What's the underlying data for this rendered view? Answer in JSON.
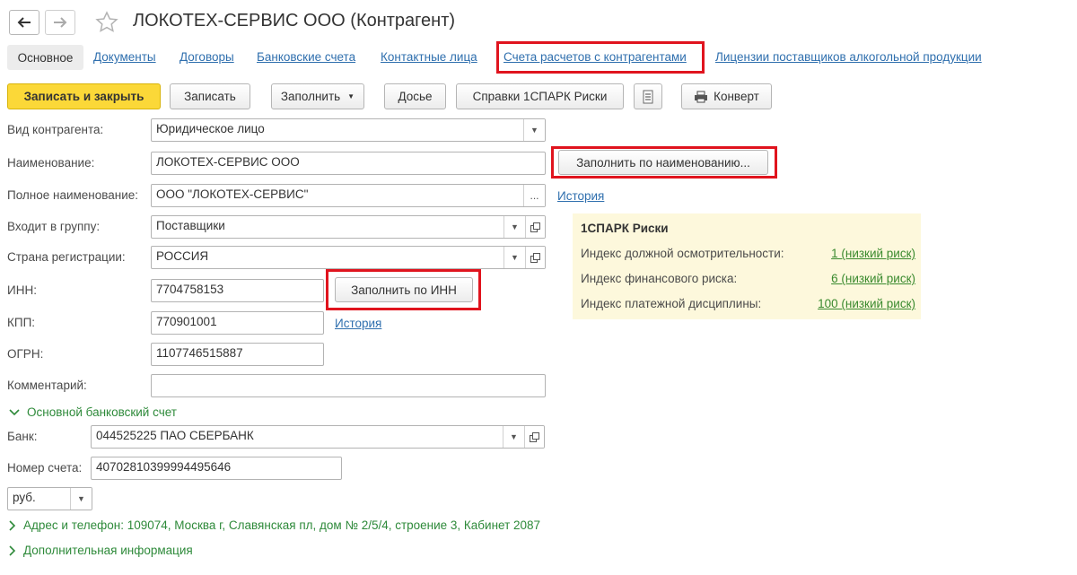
{
  "header": {
    "title": "ЛОКОТЕХ-СЕРВИС ООО (Контрагент)",
    "back_icon": "arrow-left-icon",
    "forward_icon": "arrow-right-icon",
    "favorite_icon": "star-icon"
  },
  "tabs": [
    {
      "label": "Основное",
      "active": true
    },
    {
      "label": "Документы"
    },
    {
      "label": "Договоры"
    },
    {
      "label": "Банковские счета"
    },
    {
      "label": "Контактные лица"
    },
    {
      "label": "Счета расчетов с контрагентами",
      "highlighted": true
    },
    {
      "label": "Лицензии поставщиков алкогольной продукции"
    }
  ],
  "toolbar": {
    "save_close": "Записать и закрыть",
    "save": "Записать",
    "fill": "Заполнить",
    "dossier": "Досье",
    "spark": "Справки 1СПАРК Риски",
    "convert": "Конверт"
  },
  "form": {
    "kind_label": "Вид контрагента:",
    "kind_value": "Юридическое лицо",
    "name_label": "Наименование:",
    "name_value": "ЛОКОТЕХ-СЕРВИС ООО",
    "fill_by_name": "Заполнить по наименованию...",
    "fullname_label": "Полное наименование:",
    "fullname_value": "ООО \"ЛОКОТЕХ-СЕРВИС\"",
    "fullname_more": "...",
    "history_link": "История",
    "group_label": "Входит в группу:",
    "group_value": "Поставщики",
    "country_label": "Страна регистрации:",
    "country_value": "РОССИЯ",
    "inn_label": "ИНН:",
    "inn_value": "7704758153",
    "fill_by_inn": "Заполнить по ИНН",
    "kpp_label": "КПП:",
    "kpp_value": "770901001",
    "kpp_history": "История",
    "ogrn_label": "ОГРН:",
    "ogrn_value": "1107746515887",
    "comment_label": "Комментарий:",
    "comment_value": ""
  },
  "spark": {
    "title": "1СПАРК Риски",
    "rows": [
      {
        "label": "Индекс должной осмотрительности:",
        "value": "1 (низкий риск)"
      },
      {
        "label": "Индекс финансового риска:",
        "value": "6 (низкий риск)"
      },
      {
        "label": "Индекс платежной дисциплины:",
        "value": "100 (низкий риск)"
      }
    ]
  },
  "bank": {
    "section_title": "Основной банковский счет",
    "bank_label": "Банк:",
    "bank_value": "044525225 ПАО СБЕРБАНК",
    "account_label": "Номер счета:",
    "account_value": "40702810399994495646",
    "currency_value": "руб."
  },
  "sections": {
    "address": "Адрес и телефон: 109074, Москва г, Славянская пл, дом № 2/5/4, строение 3, Кабинет 2087",
    "extra": "Дополнительная информация"
  },
  "colors": {
    "primary_button": "#fbd838",
    "link": "#2f6fae",
    "green_link": "#3a8a2e",
    "highlight_border": "#e0141e",
    "spark_bg": "#fdf8dc"
  }
}
